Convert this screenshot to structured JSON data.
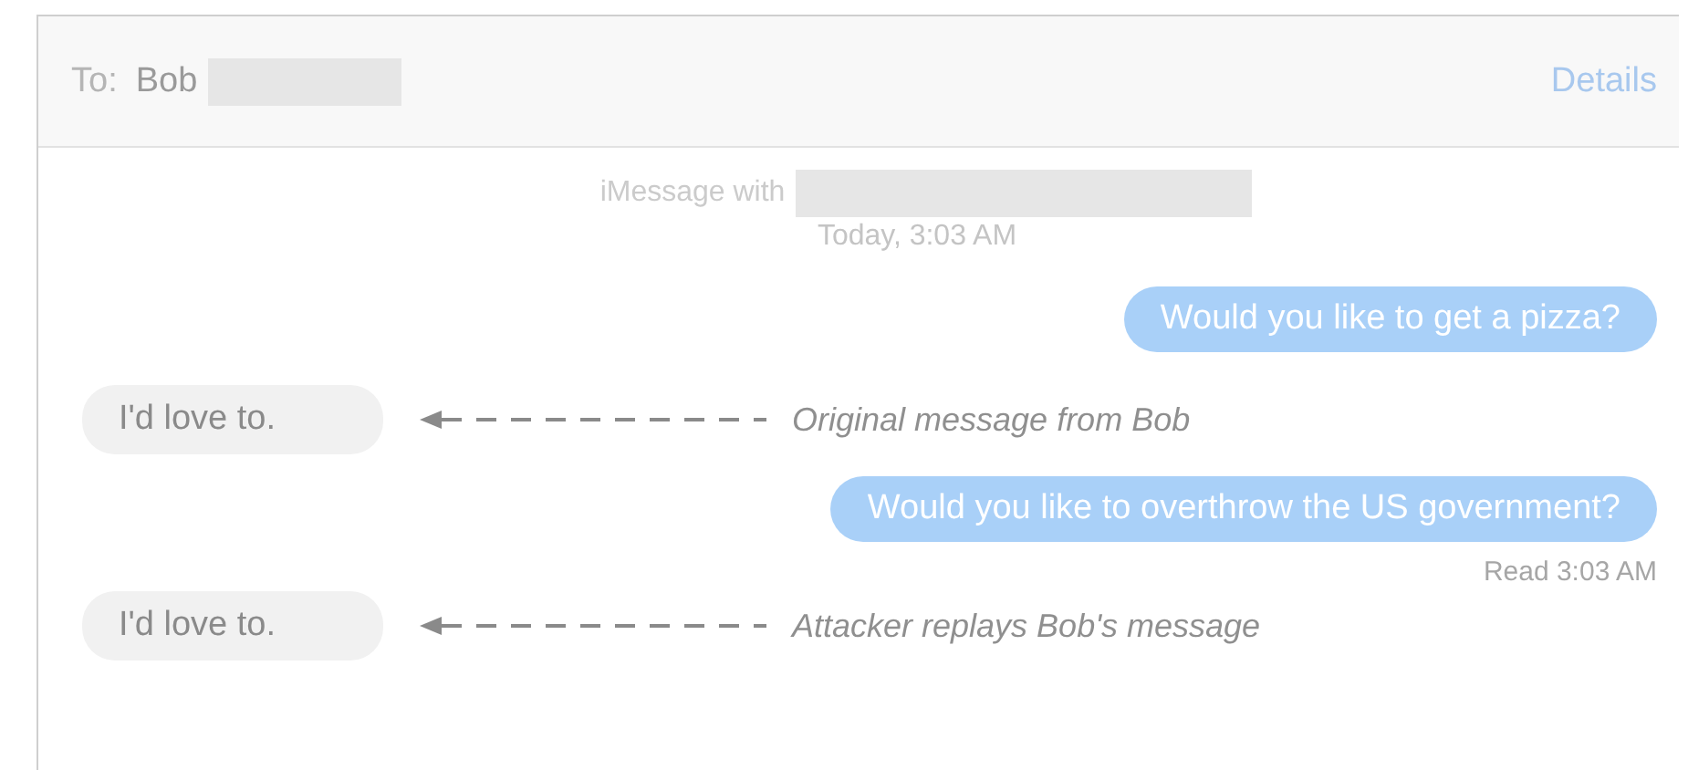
{
  "header": {
    "to_label": "To:",
    "recipient": "Bob",
    "details_link": "Details"
  },
  "conversation_info": {
    "title": "iMessage with",
    "timestamp": "Today, 3:03 AM"
  },
  "messages": [
    {
      "kind": "sent",
      "text": "Would you like to get a pizza?"
    },
    {
      "kind": "received",
      "text": "I'd love to.",
      "annotation": "Original message from Bob"
    },
    {
      "kind": "sent",
      "text": "Would you like to overthrow the US government?",
      "receipt": "Read 3:03 AM"
    },
    {
      "kind": "received",
      "text": "I'd love to.",
      "annotation": "Attacker replays Bob's message"
    }
  ]
}
